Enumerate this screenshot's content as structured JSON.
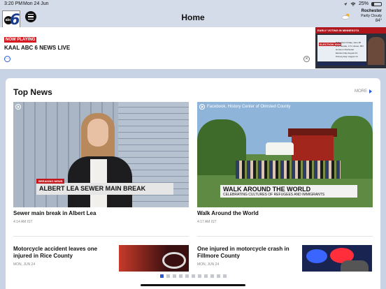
{
  "status_bar": {
    "time": "3:20 PM",
    "date": "Mon 24 Jun",
    "battery": "25%",
    "battery_level": 0.25
  },
  "nav": {
    "title": "Home",
    "logo_text": "abc",
    "logo_number": "6"
  },
  "weather": {
    "city": "Rochester",
    "condition": "Partly Cloudy",
    "temperature": "84°"
  },
  "now_playing": {
    "badge": "NOW PLAYING",
    "title": "KAAL ABC 6 NEWS LIVE",
    "thumb_header": "EARLY VOTING IN MINNESOTA",
    "thumb_tag": "ELECTION 2024",
    "thumb_lines": [
      "Polls Open Friday, June 28",
      "U.S. Senate, U.S. House, MN House in Rochester",
      "Election Day August 13",
      "Primary Day: August 13"
    ]
  },
  "section": {
    "title": "Top News",
    "more_label": "MORE"
  },
  "stories": [
    {
      "headline": "Sewer main break in Albert Lea",
      "time": "4:14 AM IST",
      "breaking_tag": "BREAKING NEWS",
      "banner": "ALBERT LEA SEWER MAIN BREAK"
    },
    {
      "headline": "Walk Around the World",
      "time": "4:17 AM IST",
      "source": "Facebook, History Center of Olmsted County",
      "banner": "WALK AROUND THE WORLD",
      "banner_sub": "CELEBRATING CULTURES OF REFUGEES AND IMMIGRANTS"
    },
    {
      "headline": "Motorcycle accident leaves one injured in Rice County",
      "time": "MON, JUN 24"
    },
    {
      "headline": "One injured in motorcycle crash in Fillmore County",
      "time": "MON, JUN 24"
    }
  ],
  "pager": {
    "count": 11,
    "active": 0
  }
}
